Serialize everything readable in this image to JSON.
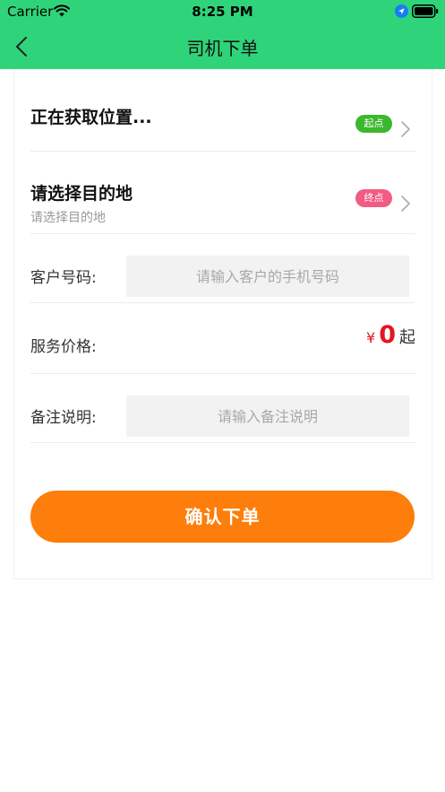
{
  "status_bar": {
    "carrier": "Carrier",
    "time": "8:25 PM"
  },
  "nav": {
    "title": "司机下单",
    "back_icon": "chevron-left-icon"
  },
  "start": {
    "title": "正在获取位置...",
    "badge": "起点",
    "badge_color": "#3cb82e"
  },
  "destination": {
    "title": "请选择目的地",
    "subtitle": "请选择目的地",
    "badge": "终点",
    "badge_color": "#f25c82"
  },
  "customer_phone": {
    "label": "客户号码:",
    "placeholder": "请输入客户的手机号码",
    "value": ""
  },
  "service_price": {
    "label": "服务价格:",
    "currency": "¥",
    "value": "0",
    "suffix": "起"
  },
  "remark": {
    "label": "备注说明:",
    "placeholder": "请输入备注说明",
    "value": ""
  },
  "confirm_button": {
    "label": "确认下单",
    "color": "#fd7e0a"
  },
  "colors": {
    "header": "#2fd47a",
    "price": "#e6141e"
  }
}
